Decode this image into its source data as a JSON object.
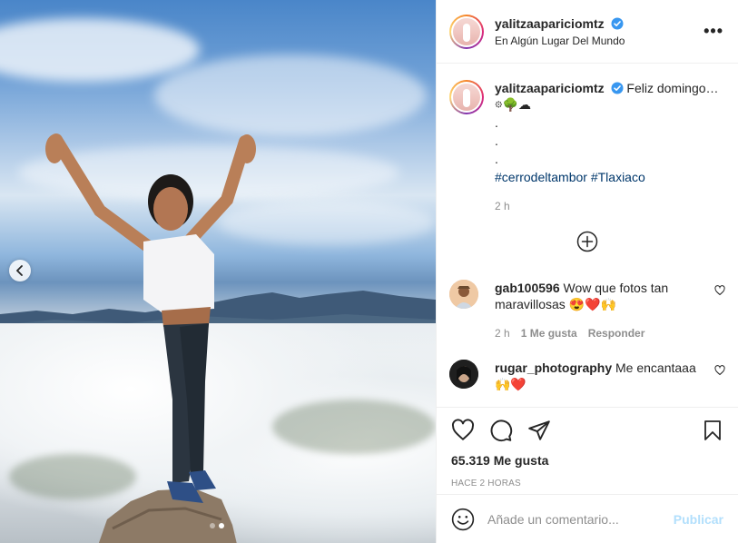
{
  "post": {
    "author": {
      "username": "yalitzaapariciomtz",
      "location": "En Algún Lugar Del Mundo",
      "verified": true
    },
    "caption": {
      "text": "Feliz domingo… 𖡼🌳☁",
      "dots": [
        ".",
        ".",
        "."
      ],
      "hashtags": [
        "#cerrodeltambor",
        "#Tlaxiaco"
      ],
      "time_ago": "2 h"
    },
    "comments": [
      {
        "username": "gab100596",
        "text": "Wow que fotos tan maravillosas 😍❤️🙌",
        "time_ago": "2 h",
        "likes_label": "1 Me gusta",
        "reply_label": "Responder"
      },
      {
        "username": "rugar_photography",
        "text": "Me encantaaa🙌❤️"
      }
    ],
    "likes_label": "65.319 Me gusta",
    "timestamp_label": "HACE 2 HORAS",
    "comment_placeholder": "Añade un comentario...",
    "publish_label": "Publicar",
    "more_label": "•••",
    "carousel": {
      "current": 2,
      "total": 2
    }
  },
  "icons": {
    "verified": "verified-badge-icon",
    "more": "more-options-icon",
    "like": "heart-icon",
    "comment": "comment-bubble-icon",
    "share": "paper-plane-icon",
    "save": "bookmark-icon",
    "emoji": "emoji-icon",
    "load_more": "plus-circle-icon",
    "prev": "chevron-left-icon"
  },
  "colors": {
    "accent_link": "#00376b",
    "verified_blue": "#3897f0",
    "publish_disabled": "#b2dffc",
    "muted": "#8e8e8e"
  }
}
